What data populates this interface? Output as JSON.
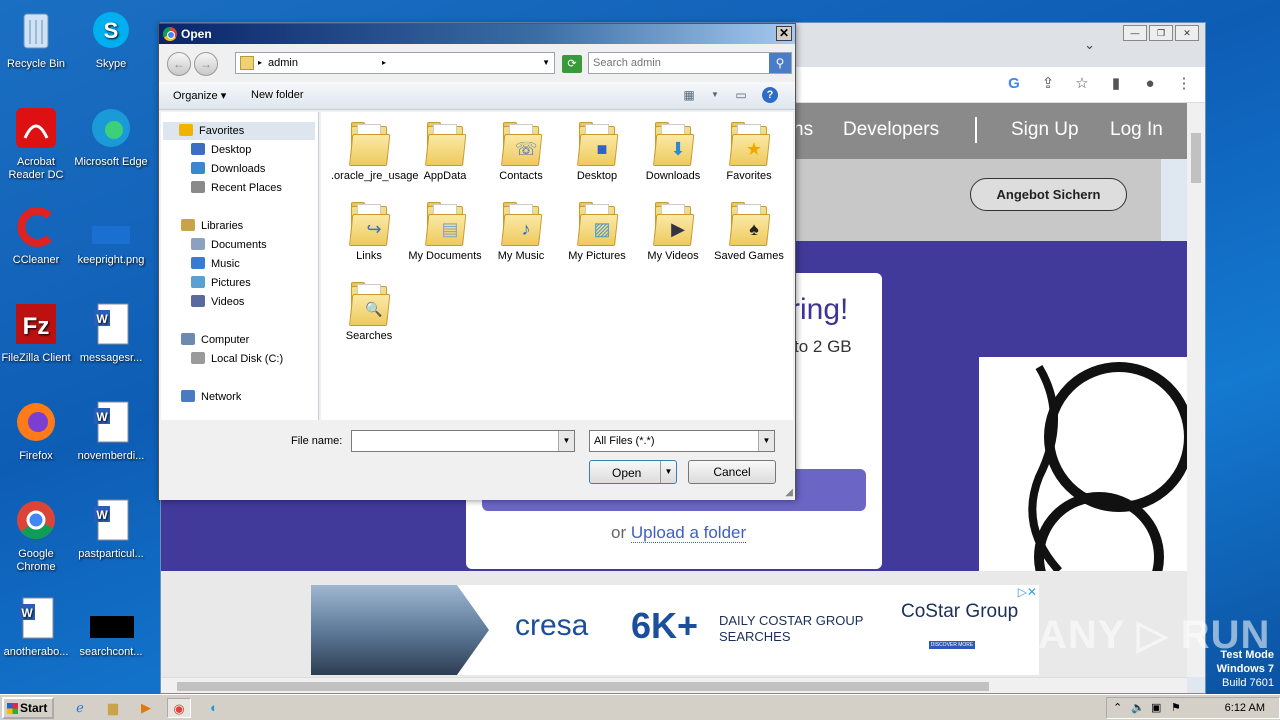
{
  "desktop": {
    "icons": [
      {
        "label": "Recycle Bin"
      },
      {
        "label": "Skype"
      },
      {
        "label": "Acrobat Reader DC"
      },
      {
        "label": "Microsoft Edge"
      },
      {
        "label": "CCleaner"
      },
      {
        "label": "keepright.png"
      },
      {
        "label": "FileZilla Client"
      },
      {
        "label": "messagesr..."
      },
      {
        "label": "Firefox"
      },
      {
        "label": "novemberdi..."
      },
      {
        "label": "Google Chrome"
      },
      {
        "label": "pastparticul..."
      },
      {
        "label": "anotherabo..."
      },
      {
        "label": "searchcont..."
      }
    ]
  },
  "browser": {
    "nav": {
      "link_partial": "ns",
      "developers": "Developers",
      "signup": "Sign Up",
      "login": "Log In"
    },
    "angebot_button": "Angebot Sichern",
    "hero_title_partial": "ring!",
    "hero_sub_partial": "to 2 GB",
    "upload_or": "or",
    "upload_folder": "Upload a folder",
    "ad": {
      "brand": "cresa",
      "stat": "6K+",
      "daily_line1": "DAILY COSTAR GROUP",
      "daily_line2": "SEARCHES",
      "costar": "CoStar Group",
      "discover": "DISCOVER MORE"
    }
  },
  "dialog": {
    "title": "Open",
    "path": "admin",
    "search_placeholder": "Search admin",
    "commands": {
      "organize": "Organize",
      "new_folder": "New folder"
    },
    "nav": [
      {
        "label": "Favorites",
        "color": "#f0b400"
      },
      {
        "label": "Desktop",
        "color": "#3a6fc4"
      },
      {
        "label": "Downloads",
        "color": "#3a88d0"
      },
      {
        "label": "Recent Places",
        "color": "#8a8a8a"
      },
      {
        "label": "Libraries",
        "color": "#c9a34a"
      },
      {
        "label": "Documents",
        "color": "#8ca0c0"
      },
      {
        "label": "Music",
        "color": "#3a7ad0"
      },
      {
        "label": "Pictures",
        "color": "#5aa0d0"
      },
      {
        "label": "Videos",
        "color": "#5a6aa0"
      },
      {
        "label": "Computer",
        "color": "#6a8ab0"
      },
      {
        "label": "Local Disk (C:)",
        "color": "#9a9a9a"
      },
      {
        "label": "Network",
        "color": "#4a7ac0"
      }
    ],
    "files": [
      {
        "label": ".oracle_jre_usage",
        "glyph": ""
      },
      {
        "label": "AppData",
        "glyph": ""
      },
      {
        "label": "Contacts",
        "glyph": "☏"
      },
      {
        "label": "Desktop",
        "glyph": "■"
      },
      {
        "label": "Downloads",
        "glyph": "⬇"
      },
      {
        "label": "Favorites",
        "glyph": "★"
      },
      {
        "label": "Links",
        "glyph": "↪"
      },
      {
        "label": "My Documents",
        "glyph": "▤"
      },
      {
        "label": "My Music",
        "glyph": "♪"
      },
      {
        "label": "My Pictures",
        "glyph": "▨"
      },
      {
        "label": "My Videos",
        "glyph": "▶"
      },
      {
        "label": "Saved Games",
        "glyph": "♠"
      },
      {
        "label": "Searches",
        "glyph": "🔍"
      }
    ],
    "file_name_label": "File name:",
    "file_name_value": "",
    "file_type": "All Files (*.*)",
    "open_button": "Open",
    "cancel_button": "Cancel"
  },
  "taskbar": {
    "start": "Start",
    "clock": "6:12 AM"
  },
  "watermark": {
    "line1": "Test Mode",
    "line2": "Windows 7",
    "line3": "Build 7601",
    "brand": "ANY ▷ RUN"
  }
}
